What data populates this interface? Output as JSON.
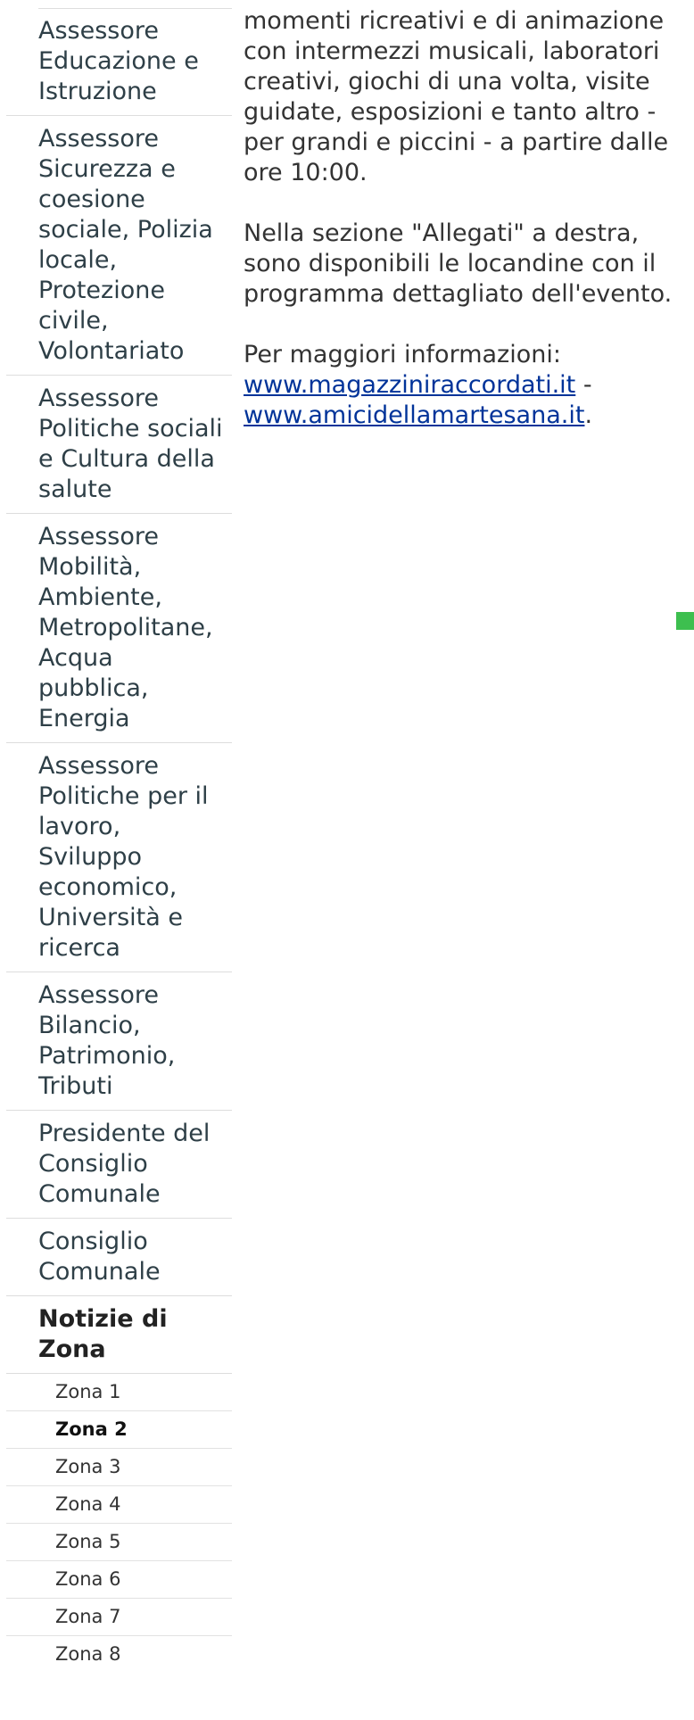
{
  "sidebar": {
    "items": [
      {
        "label": "Assessore Educazione e Istruzione"
      },
      {
        "label": "Assessore Sicurezza e coesione sociale, Polizia locale, Protezione civile, Volontariato"
      },
      {
        "label": "Assessore Politiche sociali e Cultura della salute"
      },
      {
        "label": "Assessore Mobilità, Ambiente, Metropolitane, Acqua pubblica, Energia"
      },
      {
        "label": "Assessore Politiche per il lavoro, Sviluppo economico, Università e ricerca"
      },
      {
        "label": "Assessore Bilancio, Patrimonio, Tributi"
      },
      {
        "label": "Presidente del Consiglio Comunale"
      },
      {
        "label": "Consiglio Comunale"
      }
    ],
    "section_heading": "Notizie di Zona",
    "zones": [
      {
        "label": "Zona 1"
      },
      {
        "label": "Zona 2",
        "active": true
      },
      {
        "label": "Zona 3"
      },
      {
        "label": "Zona 4"
      },
      {
        "label": "Zona 5"
      },
      {
        "label": "Zona 6"
      },
      {
        "label": "Zona 7"
      },
      {
        "label": "Zona 8"
      }
    ]
  },
  "article": {
    "paragraph_1": "momenti ricreativi e di animazione con intermezzi musicali, laboratori creativi, giochi di una volta, visite guidate, esposizioni e tanto altro - per grandi e piccini - a partire dalle ore 10:00.",
    "paragraph_2": "Nella sezione \"Allegati\" a destra, sono disponibili le locandine con il programma dettagliato dell'evento.",
    "info_label": "Per maggiori informazioni:",
    "link_1": "www.magazziniraccordati.it",
    "separator": " - ",
    "link_2": "www.amicidellamartesana.it",
    "trailing_punctuation": "."
  },
  "colors": {
    "accent_marker": "#3dbf4f",
    "link": "#003399",
    "divider": "#dddddd"
  }
}
